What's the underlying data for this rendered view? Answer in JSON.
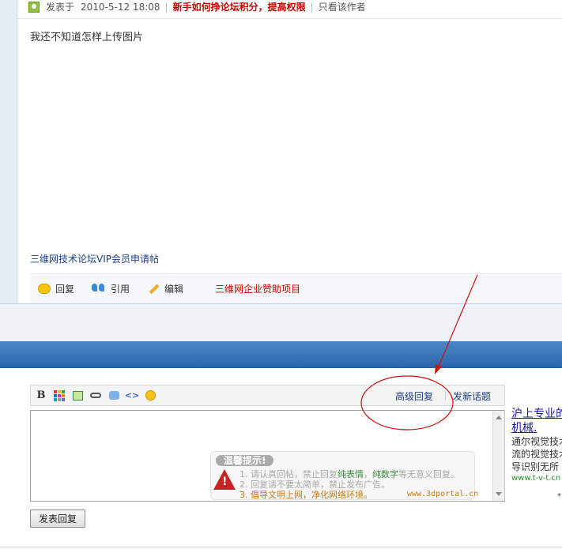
{
  "post": {
    "header": {
      "posted_label": "发表于",
      "date": "2010-5-12 18:08",
      "notice": "新手如何挣论坛积分，提高权限",
      "only_author": "只看该作者"
    },
    "body": "我还不知道怎样上传图片",
    "signature_link": "三维网技术论坛VIP会员申请帖",
    "actions": {
      "reply": "回复",
      "quote": "引用",
      "edit": "编辑",
      "sponsor": "三维网企业赞助项目"
    }
  },
  "editor": {
    "toolbar": {
      "bold": "B",
      "code_symbol": "<>",
      "advanced_reply": "高级回复",
      "new_topic": "发新话题"
    },
    "tips": {
      "title": "温馨提示!",
      "line1_prefix": "1. 请认真回帖，禁止回复",
      "line1_green1": "纯表情",
      "line1_mid": "，",
      "line1_green2": "纯数字",
      "line1_suffix": "等无意义回复。",
      "line2": "2. 回复请不要太简单，禁止发布广告。",
      "line3": "3. 倡导文明上网，净化网络环境。",
      "site": "www.3dportal.cn"
    },
    "submit_label": "发表回复"
  },
  "ad": {
    "title_line1": "沪上专业的",
    "title_line2": "机械.",
    "text_line1": "通尔视觉技术",
    "text_line2": "流的视觉技术",
    "text_line3": "导识别无所",
    "url": "www.t-v-t.cn"
  },
  "colors": {
    "notice_red": "#cc0000",
    "link_blue": "#1a3e8c",
    "band_blue": "#2a64a8",
    "annotation_red": "#cc1111"
  }
}
